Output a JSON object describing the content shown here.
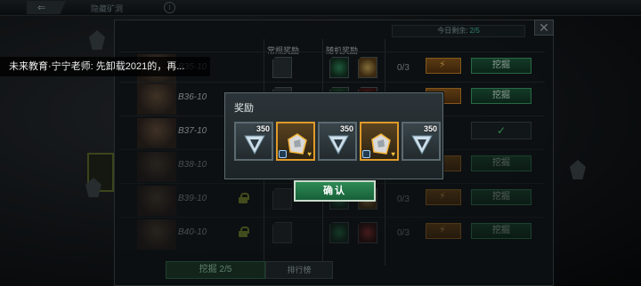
{
  "topbar": {
    "back_label": "⇐",
    "title": "隐藏矿洞",
    "info_icon": "i"
  },
  "panel": {
    "remaining_label": "今日剩余: ",
    "remaining_value": "2/5",
    "col_normal": "常规奖励",
    "col_random": "随机奖励",
    "close_icon": "✕"
  },
  "rows": [
    {
      "stage": "B35-10",
      "count": "0/3",
      "dig": "挖掘",
      "state": "available"
    },
    {
      "stage": "B36-10",
      "count": "",
      "dig": "挖掘",
      "state": "available"
    },
    {
      "stage": "B37-10",
      "count": "",
      "dig": "",
      "state": "done"
    },
    {
      "stage": "B38-10",
      "count": "",
      "dig": "挖掘",
      "state": "available"
    },
    {
      "stage": "B39-10",
      "count": "0/3",
      "dig": "挖掘",
      "state": "locked"
    },
    {
      "stage": "B40-10",
      "count": "0/3",
      "dig": "挖掘",
      "state": "locked"
    }
  ],
  "done_icon": "✓",
  "bottom": {
    "dig_count": "挖掘 2/5",
    "rank": "排行榜"
  },
  "chat": {
    "text": "未来教育·宁宁老师: 先卸载2021的，再..."
  },
  "dialog": {
    "title": "奖励",
    "items": [
      {
        "qty": "350",
        "kind": "crystal-card",
        "legend": false
      },
      {
        "qty": "",
        "kind": "ore-chunk",
        "legend": true
      },
      {
        "qty": "350",
        "kind": "crystal-card",
        "legend": false
      },
      {
        "qty": "",
        "kind": "ore-chunk",
        "legend": true
      },
      {
        "qty": "350",
        "kind": "crystal-card",
        "legend": false
      }
    ],
    "confirm": "确认"
  }
}
